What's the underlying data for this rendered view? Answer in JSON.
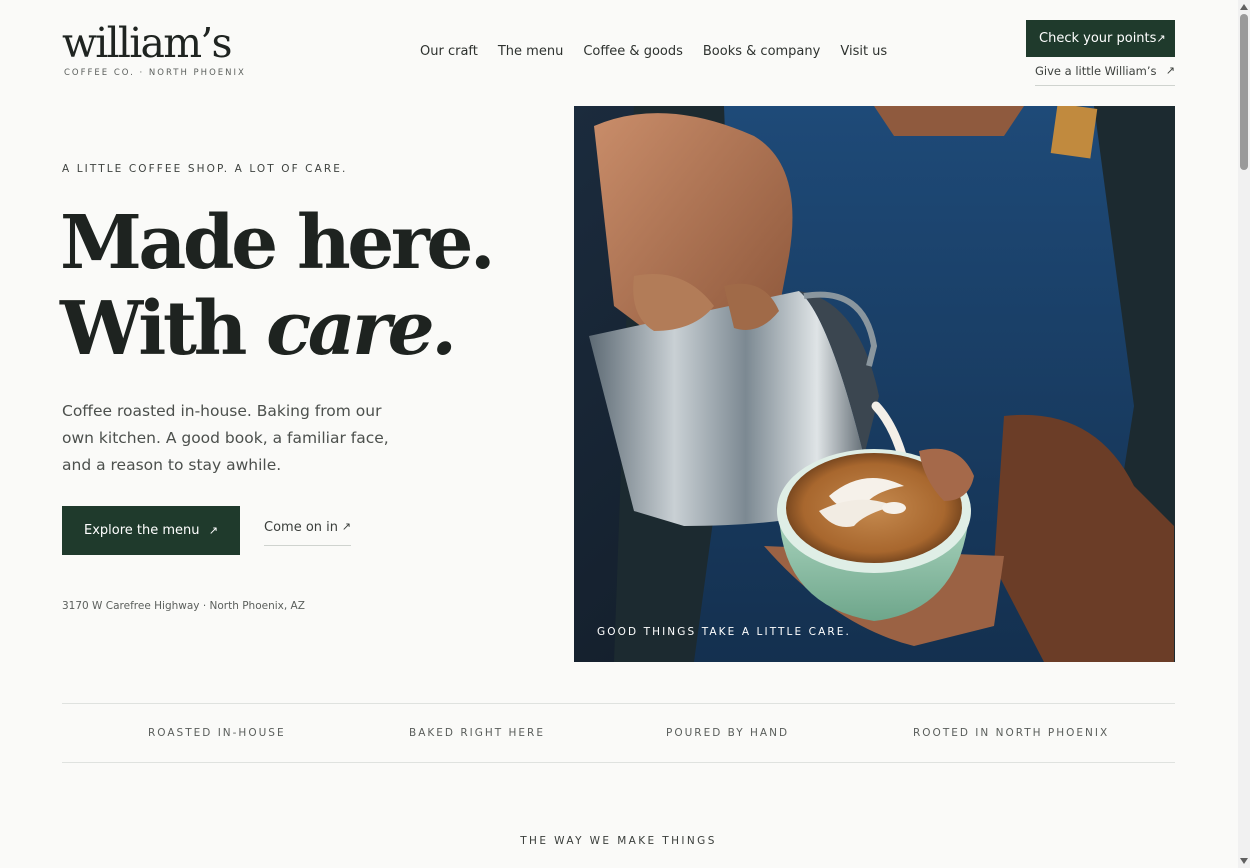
{
  "header": {
    "brand_name": "william’s",
    "brand_sub": "COFFEE CO. · NORTH PHOENIX",
    "nav": [
      "Our craft",
      "The menu",
      "Coffee & goods",
      "Books & company",
      "Visit us"
    ],
    "points_button": "Check your points",
    "gift_link": "Give a little William’s",
    "arrow": "↗"
  },
  "hero": {
    "eyebrow": "A LITTLE COFFEE SHOP. A LOT OF CARE.",
    "headline_line1": "Made here.",
    "headline_line2_prefix": "With ",
    "headline_line2_em": "care.",
    "lede": "Coffee roasted in-house. Baking from our own kitchen. A good book, a familiar face, and a reason to stay awhile.",
    "cta_primary": "Explore the menu",
    "cta_secondary": "Come on in",
    "address": "3170 W Carefree Highway · North Phoenix, AZ",
    "photo_caption": "GOOD THINGS TAKE A LITTLE CARE."
  },
  "values": [
    "ROASTED IN-HOUSE",
    "BAKED RIGHT HERE",
    "POURED BY HAND",
    "ROOTED IN NORTH PHOENIX"
  ],
  "next_section": {
    "heading": "THE WAY WE MAKE THINGS"
  },
  "colors": {
    "brand_green": "#1f3a2c",
    "background": "#fafaf8",
    "text": "#2a2d2b"
  }
}
